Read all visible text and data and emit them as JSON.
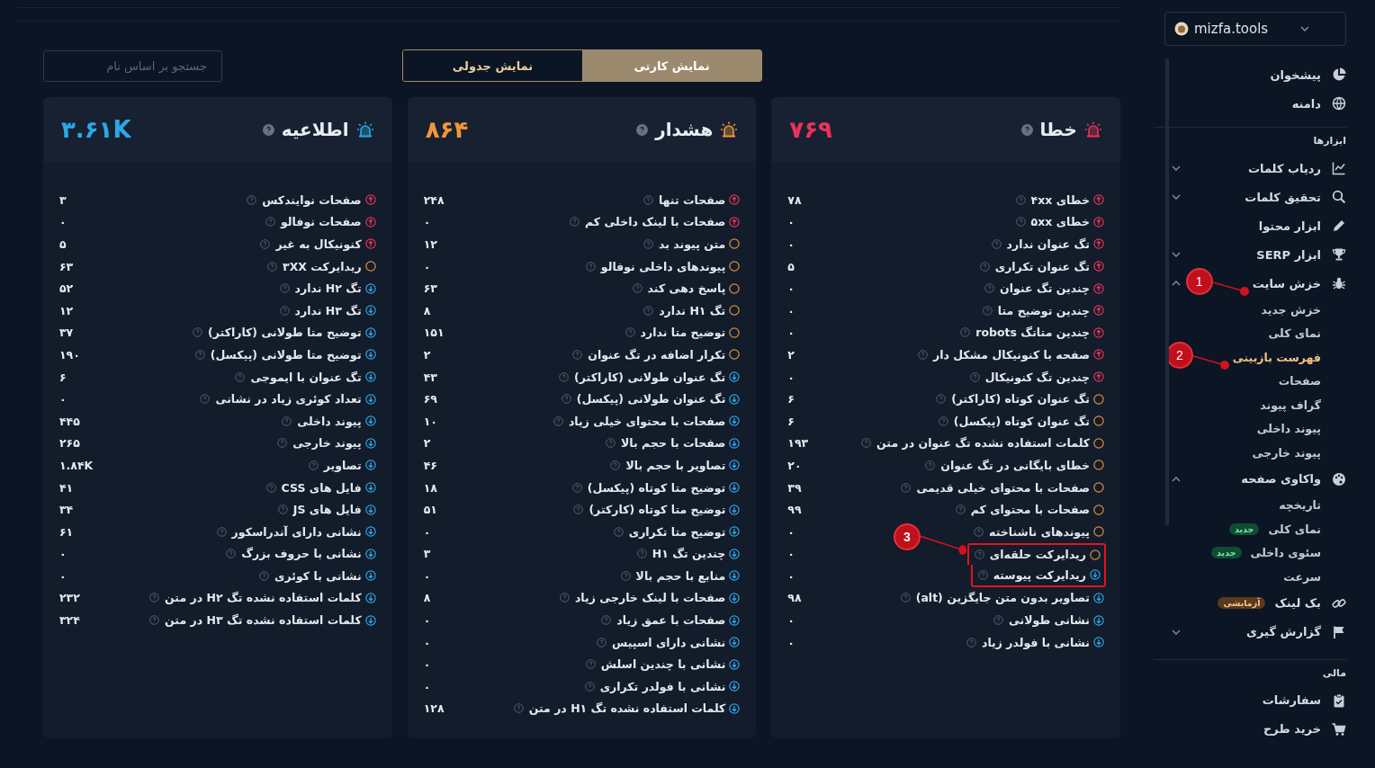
{
  "toolbar": {
    "search": {
      "placeholder": "جستجو بر اساس نام"
    },
    "view_toggle": [
      {
        "label": "نمایش کارتی",
        "selected": true
      },
      {
        "label": "نمایش جدولی",
        "selected": false
      }
    ]
  },
  "cards": [
    {
      "kind": "error",
      "title": "خطا",
      "total": "۷۶۹",
      "rows": [
        {
          "kind": "up",
          "label": "خطای ۴xx",
          "value": "۷۸"
        },
        {
          "kind": "up",
          "label": "خطای ۵xx",
          "value": "۰"
        },
        {
          "kind": "up",
          "label": "تگ عنوان ندارد",
          "value": "۰"
        },
        {
          "kind": "up",
          "label": "تگ عنوان تکراری",
          "value": "۵"
        },
        {
          "kind": "up",
          "label": "چندین تگ عنوان",
          "value": "۰"
        },
        {
          "kind": "up",
          "label": "چندین توضیح متا",
          "value": "۰"
        },
        {
          "kind": "up",
          "label": "چندین متاتگ robots",
          "value": "۰"
        },
        {
          "kind": "up",
          "label": "صفحه با کنونیکال مشکل دار",
          "value": "۲"
        },
        {
          "kind": "up",
          "label": "چندین تگ کنونیکال",
          "value": "۰"
        },
        {
          "kind": "ring",
          "label": "تگ عنوان کوتاه (کاراکتر)",
          "value": "۶"
        },
        {
          "kind": "ring",
          "label": "تگ عنوان کوتاه (پیکسل)",
          "value": "۶"
        },
        {
          "kind": "ring",
          "label": "کلمات استفاده نشده تگ عنوان در متن",
          "value": "۱۹۳"
        },
        {
          "kind": "ring",
          "label": "خطای بایگانی در تگ عنوان",
          "value": "۲۰"
        },
        {
          "kind": "ring",
          "label": "صفحات با محتوای خیلی قدیمی",
          "value": "۳۹"
        },
        {
          "kind": "ring",
          "label": "صفحات با محتوای کم",
          "value": "۹۹"
        },
        {
          "kind": "ring",
          "label": "پیوندهای ناشناخته",
          "value": "۰"
        },
        {
          "kind": "ring",
          "label": "ریدایرکت حلقه‌ای",
          "value": "۰",
          "outlined": true,
          "callout": "3"
        },
        {
          "kind": "down",
          "label": "ریدایرکت پیوسته",
          "value": "۰",
          "outlined": true
        },
        {
          "kind": "down",
          "label": "تصاویر بدون متن جایگزین (alt)",
          "value": "۹۸"
        },
        {
          "kind": "down",
          "label": "نشانی طولانی",
          "value": "۰"
        },
        {
          "kind": "down",
          "label": "نشانی با فولدر زیاد",
          "value": "۰"
        }
      ]
    },
    {
      "kind": "warning",
      "title": "هشدار",
      "total": "۸۶۴",
      "rows": [
        {
          "kind": "up",
          "label": "صفحات تنها",
          "value": "۲۴۸"
        },
        {
          "kind": "up",
          "label": "صفحات با لینک داخلی کم",
          "value": "۰"
        },
        {
          "kind": "ring",
          "label": "متن پیوند بد",
          "value": "۱۲"
        },
        {
          "kind": "ring",
          "label": "پیوندهای داخلی نوفالو",
          "value": "۰"
        },
        {
          "kind": "ring",
          "label": "پاسخ دهی کند",
          "value": "۶۳"
        },
        {
          "kind": "ring",
          "label": "تگ H۱ ندارد",
          "value": "۸"
        },
        {
          "kind": "ring",
          "label": "توضیح متا ندارد",
          "value": "۱۵۱"
        },
        {
          "kind": "ring",
          "label": "تکرار اضافه در تگ عنوان",
          "value": "۲"
        },
        {
          "kind": "down",
          "label": "تگ عنوان طولانی (کاراکتر)",
          "value": "۴۳"
        },
        {
          "kind": "down",
          "label": "تگ عنوان طولانی (پیکسل)",
          "value": "۶۹"
        },
        {
          "kind": "down",
          "label": "صفحات با محتوای خیلی زیاد",
          "value": "۱۰"
        },
        {
          "kind": "down",
          "label": "صفحات با حجم بالا",
          "value": "۲"
        },
        {
          "kind": "down",
          "label": "تصاویر با حجم بالا",
          "value": "۴۶"
        },
        {
          "kind": "down",
          "label": "توضیح متا کوتاه (پیکسل)",
          "value": "۱۸"
        },
        {
          "kind": "down",
          "label": "توضیح متا کوتاه (کارکتر)",
          "value": "۵۱"
        },
        {
          "kind": "down",
          "label": "توضیح متا تکراری",
          "value": "۰"
        },
        {
          "kind": "down",
          "label": "چندین تگ H۱",
          "value": "۳"
        },
        {
          "kind": "down",
          "label": "منابع با حجم بالا",
          "value": "۰"
        },
        {
          "kind": "down",
          "label": "صفحات با لینک خارجی زیاد",
          "value": "۸"
        },
        {
          "kind": "down",
          "label": "صفحات با عمق زیاد",
          "value": "۰"
        },
        {
          "kind": "down",
          "label": "نشانی دارای اسپیس",
          "value": "۰"
        },
        {
          "kind": "down",
          "label": "نشانی با چندین اسلش",
          "value": "۰"
        },
        {
          "kind": "down",
          "label": "نشانی با فولدر تکراری",
          "value": "۰"
        },
        {
          "kind": "down",
          "label": "کلمات استفاده نشده تگ H۱ در متن",
          "value": "۱۲۸"
        }
      ]
    },
    {
      "kind": "notice",
      "title": "اطلاعیه",
      "total": "۳.۶۱K",
      "rows": [
        {
          "kind": "up",
          "label": "صفحات نوایندکس",
          "value": "۳"
        },
        {
          "kind": "up",
          "label": "صفحات نوفالو",
          "value": "۰"
        },
        {
          "kind": "up",
          "label": "کنونیکال به غیر",
          "value": "۵"
        },
        {
          "kind": "ring",
          "label": "ریدایرکت ۳XX",
          "value": "۶۳"
        },
        {
          "kind": "down",
          "label": "تگ H۲ ندارد",
          "value": "۵۲"
        },
        {
          "kind": "down",
          "label": "تگ H۳ ندارد",
          "value": "۱۲"
        },
        {
          "kind": "down",
          "label": "توضیح متا طولانی (کاراکتر)",
          "value": "۳۷"
        },
        {
          "kind": "down",
          "label": "توضیح متا طولانی (پیکسل)",
          "value": "۱۹۰"
        },
        {
          "kind": "down",
          "label": "تگ عنوان با ایموجی",
          "value": "۶"
        },
        {
          "kind": "down",
          "label": "تعداد کوئری زیاد در نشانی",
          "value": "۰"
        },
        {
          "kind": "down",
          "label": "پیوند داخلی",
          "value": "۴۴۵"
        },
        {
          "kind": "down",
          "label": "پیوند خارجی",
          "value": "۲۶۵"
        },
        {
          "kind": "down",
          "label": "تصاویر",
          "value": "۱.۸۴K"
        },
        {
          "kind": "down",
          "label": "فایل های CSS",
          "value": "۴۱"
        },
        {
          "kind": "down",
          "label": "فایل های JS",
          "value": "۳۴"
        },
        {
          "kind": "down",
          "label": "نشانی دارای آندراسکور",
          "value": "۶۱"
        },
        {
          "kind": "down",
          "label": "نشانی با حروف بزرگ",
          "value": "۰"
        },
        {
          "kind": "down",
          "label": "نشانی با کوئری",
          "value": "۰"
        },
        {
          "kind": "down",
          "label": "کلمات استفاده نشده تگ H۲ در متن",
          "value": "۲۳۲"
        },
        {
          "kind": "down",
          "label": "کلمات استفاده نشده تگ H۳ در متن",
          "value": "۳۲۴"
        }
      ]
    }
  ],
  "sidebar": {
    "project": "mizfa.tools",
    "items": [
      {
        "kind": "item",
        "label": "پیشخوان"
      },
      {
        "kind": "item",
        "label": "دامنه"
      },
      {
        "kind": "heading",
        "label": "ابزارها"
      },
      {
        "kind": "item",
        "label": "ردیاب کلمات",
        "expanded": false
      },
      {
        "kind": "item",
        "label": "تحقیق کلمات",
        "expanded": false
      },
      {
        "kind": "item",
        "label": "ابزار محتوا"
      },
      {
        "kind": "item",
        "label": "ابزار SERP",
        "expanded": false
      },
      {
        "kind": "item",
        "label": "خزش سایت",
        "expanded": true,
        "callout": "1",
        "children": [
          {
            "label": "خزش جدید",
            "selected": false
          },
          {
            "label": "نمای کلی",
            "selected": false
          },
          {
            "label": "فهرست بازبینی",
            "selected": true,
            "callout": "2"
          },
          {
            "label": "صفحات",
            "selected": false
          },
          {
            "label": "گراف پیوند",
            "selected": false
          },
          {
            "label": "پیوند داخلی",
            "selected": false
          },
          {
            "label": "پیوند خارجی",
            "selected": false
          }
        ]
      },
      {
        "kind": "item",
        "label": "واکاوی صفحه",
        "expanded": true,
        "children": [
          {
            "label": "تاریخچه",
            "selected": false
          },
          {
            "label": "نمای کلی",
            "selected": false,
            "badge": {
              "text": "جدید",
              "color": "#0f4d33"
            }
          },
          {
            "label": "سئوی داخلی",
            "selected": false,
            "badge": {
              "text": "جدید",
              "color": "#0f4d33"
            }
          },
          {
            "label": "سرعت",
            "selected": false
          }
        ]
      },
      {
        "kind": "item",
        "label": "بک لینک",
        "badge": {
          "text": "آزمایشی",
          "color": "#5a3a1c"
        }
      },
      {
        "kind": "item",
        "label": "گزارش گیری",
        "expanded": false
      },
      {
        "kind": "heading",
        "label": "مالی"
      },
      {
        "kind": "item",
        "label": "سفارشات"
      },
      {
        "kind": "item",
        "label": "خرید طرح"
      }
    ]
  }
}
